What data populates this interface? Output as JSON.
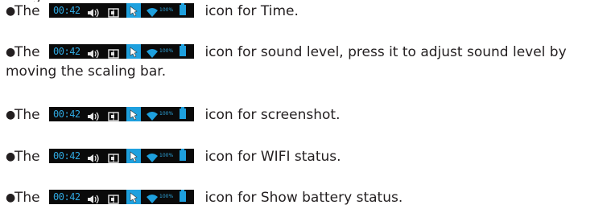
{
  "partial_top_text": "g",
  "lead_word": "The",
  "status_bar": {
    "time": "00:42",
    "battery_percent": "100%",
    "icons": [
      "volume-icon",
      "screenshot-icon",
      "cursor-icon",
      "wifi-icon",
      "battery-icon"
    ],
    "background_color": "#0a0a0a",
    "accent_color": "#1ea0de"
  },
  "items": [
    {
      "text": "icon for Time."
    },
    {
      "text": "icon for sound level, press it to adjust sound level by",
      "continuation": "moving the scaling bar."
    },
    {
      "text": "icon for screenshot."
    },
    {
      "text": "icon for WIFI status."
    },
    {
      "text": "icon for Show battery status."
    }
  ]
}
